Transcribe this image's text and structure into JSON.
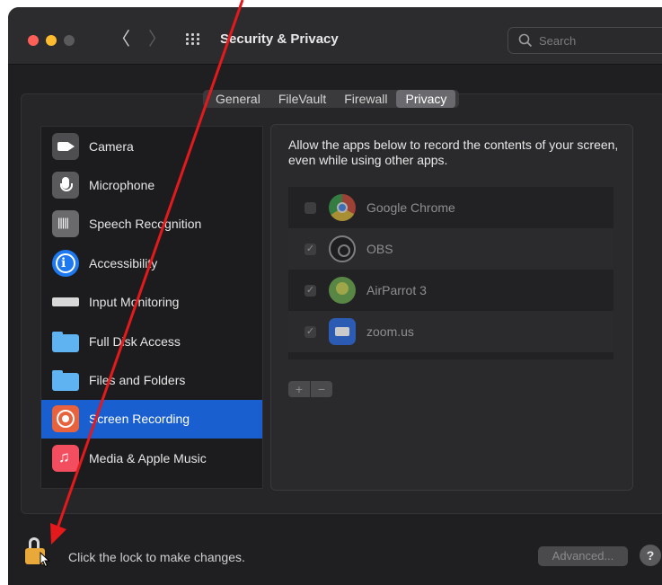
{
  "window": {
    "title": "Security & Privacy",
    "back_glyph": "〈",
    "forward_glyph": "〉"
  },
  "search": {
    "placeholder": "Search"
  },
  "tabs": [
    {
      "label": "General",
      "active": false
    },
    {
      "label": "FileVault",
      "active": false
    },
    {
      "label": "Firewall",
      "active": false
    },
    {
      "label": "Privacy",
      "active": true
    }
  ],
  "sidebar": {
    "items": [
      {
        "label": "Camera",
        "icon": "camera-icon"
      },
      {
        "label": "Microphone",
        "icon": "microphone-icon"
      },
      {
        "label": "Speech Recognition",
        "icon": "speech-recognition-icon"
      },
      {
        "label": "Accessibility",
        "icon": "accessibility-icon"
      },
      {
        "label": "Input Monitoring",
        "icon": "keyboard-icon"
      },
      {
        "label": "Full Disk Access",
        "icon": "folder-icon"
      },
      {
        "label": "Files and Folders",
        "icon": "folder-icon"
      },
      {
        "label": "Screen Recording",
        "icon": "screen-recording-icon",
        "selected": true
      },
      {
        "label": "Media & Apple Music",
        "icon": "music-icon"
      }
    ]
  },
  "main": {
    "description": "Allow the apps below to record the contents of your screen, even while using other apps.",
    "apps": [
      {
        "name": "Google Chrome",
        "checked": false,
        "icon": "chrome-icon"
      },
      {
        "name": "OBS",
        "checked": true,
        "icon": "obs-icon"
      },
      {
        "name": "AirParrot 3",
        "checked": true,
        "icon": "airparrot-icon"
      },
      {
        "name": "zoom.us",
        "checked": true,
        "icon": "zoom-icon"
      }
    ],
    "add_label": "+",
    "remove_label": "−"
  },
  "footer": {
    "lock_message": "Click the lock to make changes.",
    "advanced_label": "Advanced...",
    "help_label": "?"
  },
  "colors": {
    "selection": "#1a5fd0",
    "window_bg": "#1f1f21",
    "arrow": "#e3191c",
    "lock": "#e9a93a"
  }
}
